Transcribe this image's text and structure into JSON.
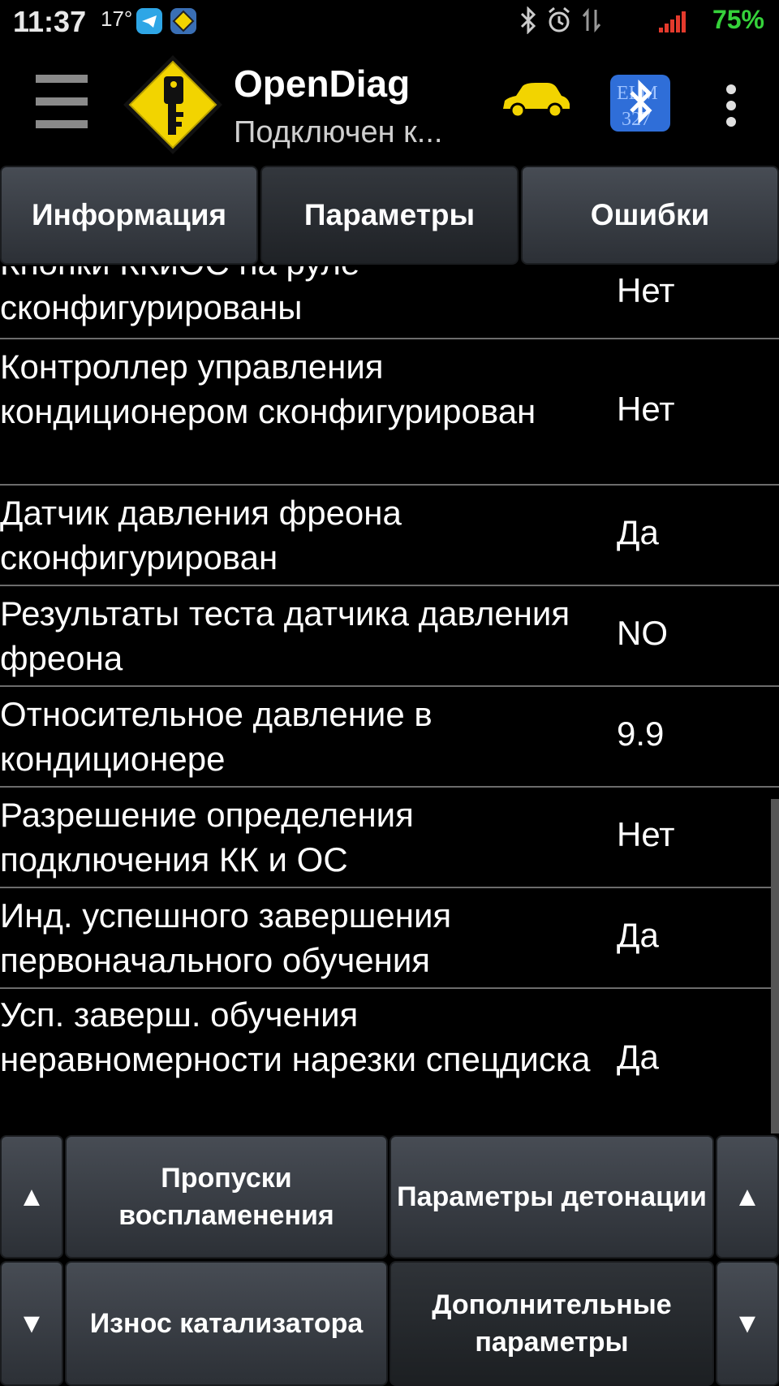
{
  "status_bar": {
    "time": "11:37",
    "temperature": "17°",
    "battery": "75%",
    "battery_color": "#35d23a",
    "icons": [
      "telegram-icon",
      "opendiag-notification-icon",
      "bluetooth-icon",
      "alarm-icon",
      "data-transfer-icon",
      "signal-icon"
    ]
  },
  "action_bar": {
    "title": "OpenDiag",
    "subtitle": "Подключен к...",
    "icons": [
      "menu-icon",
      "opendiag-logo",
      "car-icon",
      "elm327-bluetooth-icon",
      "overflow-menu-icon"
    ]
  },
  "tabs": [
    {
      "label": "Информация",
      "active": false
    },
    {
      "label": "Параметры",
      "active": true
    },
    {
      "label": "Ошибки",
      "active": false
    }
  ],
  "parameters": [
    {
      "label": "Кнопки ККиОС на руле сконфигурированы",
      "value": "Нет"
    },
    {
      "label": "Контроллер управления кондиционером сконфигурирован",
      "value": "Нет"
    },
    {
      "label": "Датчик давления фреона сконфигурирован",
      "value": "Да"
    },
    {
      "label": "Результаты теста датчика давления фреона",
      "value": "NO"
    },
    {
      "label": "Относительное давление в кондиционере",
      "value": "9.9"
    },
    {
      "label": "Разрешение определения подключения КК и ОС",
      "value": "Нет"
    },
    {
      "label": "Инд. успешного завершения первоначального обучения",
      "value": "Да"
    },
    {
      "label": "Усп. заверш. обучения неравномерности нарезки спецдиска",
      "value": "Да"
    }
  ],
  "bottom_buttons": {
    "up_left": "▲",
    "up_right": "▲",
    "down_left": "▼",
    "down_right": "▼",
    "misfires": "Пропуски воспламенения",
    "detonation": "Параметры детонации",
    "catalyst": "Износ катализатора",
    "additional": "Дополнительные параметры"
  },
  "colors": {
    "background": "#000000",
    "button_gradient_top": "#474c54",
    "button_gradient_bottom": "#2c3036",
    "divider": "#6c6c6c",
    "logo_yellow": "#f2d400"
  }
}
